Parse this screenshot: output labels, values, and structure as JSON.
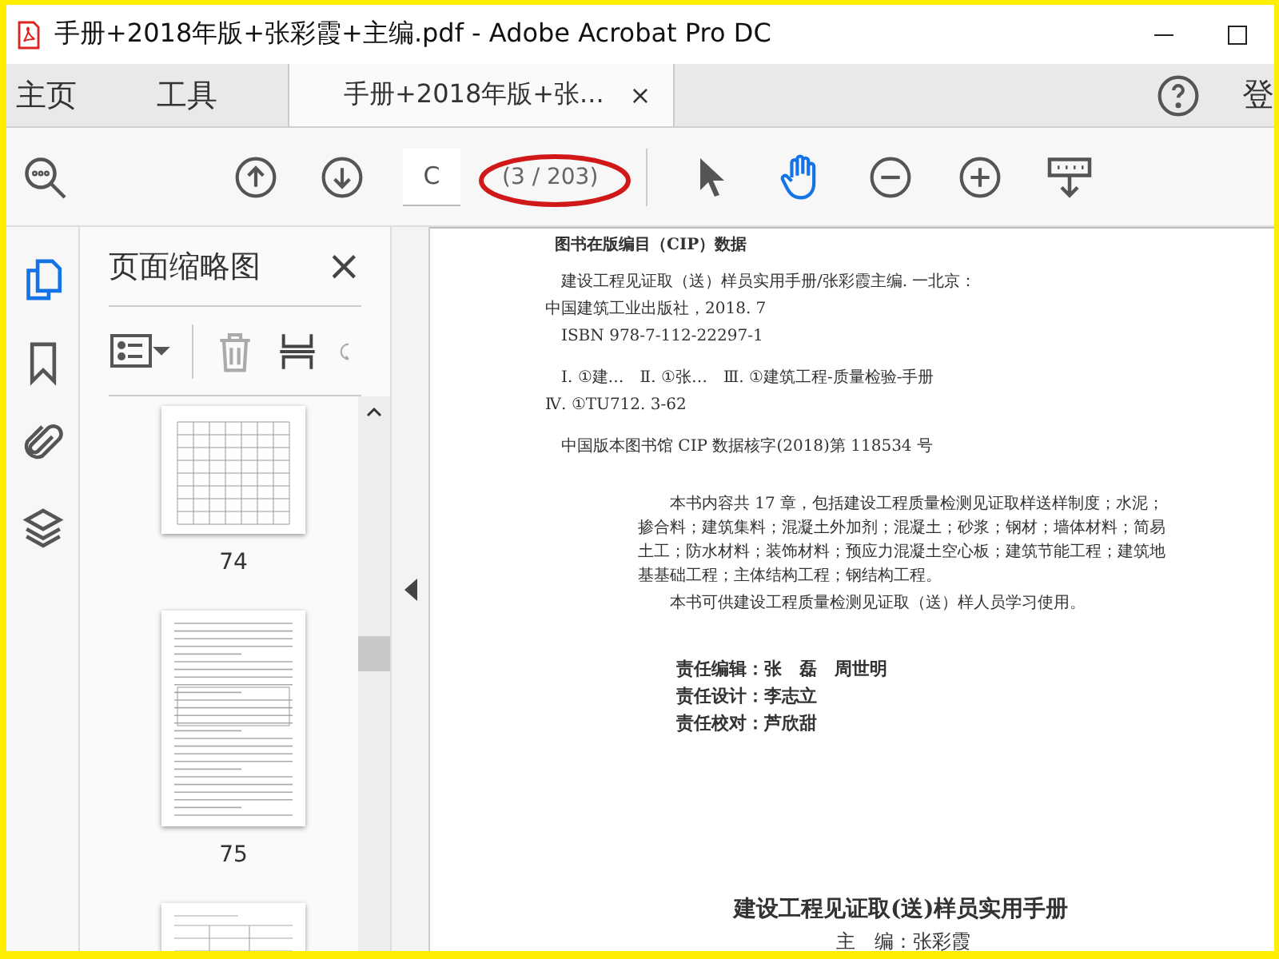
{
  "window": {
    "title": "手册+2018年版+张彩霞+主编.pdf - Adobe Acrobat Pro DC"
  },
  "tabs": [
    {
      "label": "主页",
      "kind": "nav",
      "selected": false
    },
    {
      "label": "工具",
      "kind": "nav",
      "selected": false
    },
    {
      "label": "手册+2018年版+张...",
      "kind": "document",
      "selected": true,
      "close": "×"
    }
  ],
  "account_label": "登",
  "toolbar": {
    "page_input": "C",
    "page_count": "(3 / 203)",
    "page_count_circled": true,
    "tools": [
      {
        "kind": "select",
        "selected": false
      },
      {
        "kind": "hand",
        "selected": true
      }
    ]
  },
  "rail": [
    {
      "kind": "pages",
      "selected": true
    },
    {
      "kind": "bookmarks",
      "selected": false
    },
    {
      "kind": "attachments",
      "selected": false
    },
    {
      "kind": "layers",
      "selected": false
    }
  ],
  "thumbnail_panel": {
    "title": "页面缩略图",
    "close": "×",
    "thumbnails": [
      {
        "label": "74",
        "kind": "table"
      },
      {
        "label": "75",
        "kind": "text"
      }
    ]
  },
  "document": {
    "heading": "图书在版编目（CIP）数据",
    "cip_lines": [
      "建设工程见证取（送）样员实用手册/张彩霞主编. 一北京：",
      "中国建筑工业出版社，2018. 7",
      "ISBN 978-7-112-22297-1",
      "Ⅰ. ①建…　Ⅱ. ①张…　Ⅲ. ①建筑工程-质量检验-手册",
      "Ⅳ. ①TU712. 3-62",
      "中国版本图书馆 CIP 数据核字(2018)第 118534 号"
    ],
    "summary": [
      "本书内容共 17 章，包括建设工程质量检测见证取样送样制度；水泥；掺合料；建筑集料；混凝土外加剂；混凝土；砂浆；钢材；墙体材料；简易土工；防水材料；装饰材料；预应力混凝土空心板；建筑节能工程；建筑地基基础工程；主体结构工程；钢结构工程。",
      "本书可供建设工程质量检测见证取（送）样人员学习使用。"
    ],
    "credits": [
      {
        "role": "责任编辑：",
        "name": "张　磊　周世明"
      },
      {
        "role": "责任设计：",
        "name": "李志立"
      },
      {
        "role": "责任校对：",
        "name": "芦欣甜"
      }
    ],
    "book_title": "建设工程见证取(送)样员实用手册",
    "editor": "主　编：张彩霞"
  }
}
